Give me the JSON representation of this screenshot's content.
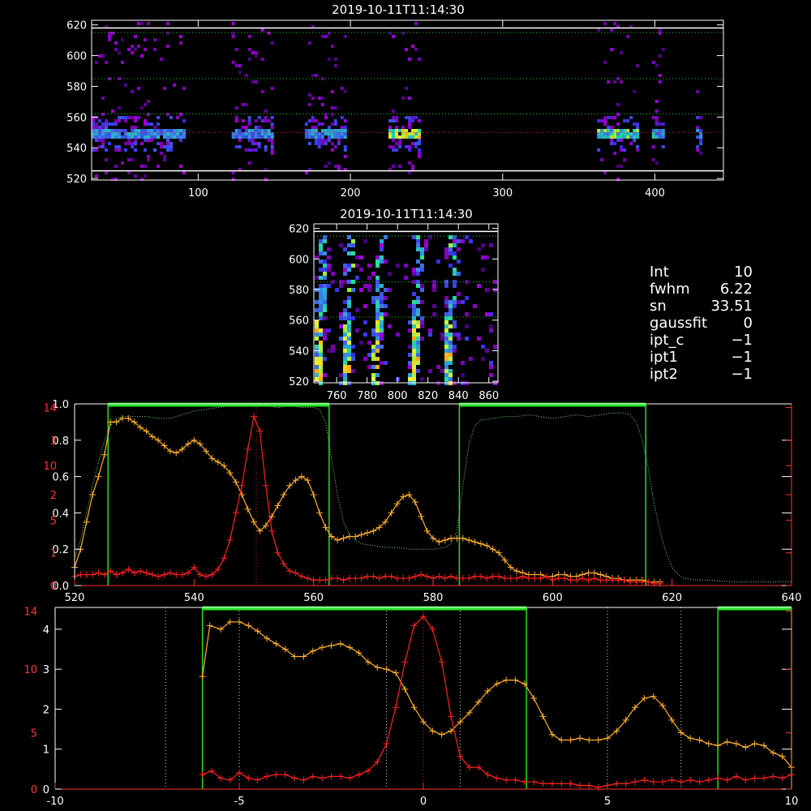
{
  "chart_data": [
    {
      "id": "top_image",
      "type": "heatmap",
      "title": "2019-10-11T11:14:30",
      "xlim": [
        30,
        445
      ],
      "ylim": [
        519,
        623
      ],
      "xticks": [
        100,
        200,
        300,
        400
      ],
      "yticks": [
        520,
        540,
        560,
        580,
        600,
        620
      ],
      "hlines_white": [
        618,
        525
      ],
      "hlines_green": [
        615,
        585,
        562
      ],
      "hlines_red": [
        550
      ],
      "bands": [
        [
          30,
          90
        ],
        [
          122,
          148
        ],
        [
          170,
          197
        ],
        [
          225,
          245
        ],
        [
          362,
          388
        ],
        [
          398,
          405
        ],
        [
          427,
          431
        ]
      ],
      "band_intensity": [
        0.55,
        0.55,
        0.55,
        0.95,
        0.75,
        0.6,
        0.5
      ]
    },
    {
      "id": "zoom_image",
      "type": "heatmap",
      "title": "2019-10-11T11:14:30",
      "xlim": [
        745,
        866
      ],
      "ylim": [
        519,
        623
      ],
      "xticks": [
        760,
        780,
        800,
        820,
        840,
        860
      ],
      "yticks": [
        520,
        540,
        560,
        580,
        600,
        620
      ],
      "hlines_white": [
        618
      ],
      "hlines_green": [
        615,
        585,
        562
      ],
      "streaks": [
        747,
        765,
        785,
        810,
        832
      ]
    },
    {
      "id": "info",
      "type": "table",
      "rows": [
        {
          "label": "Int",
          "value": "10"
        },
        {
          "label": "fwhm",
          "value": "6.22"
        },
        {
          "label": "sn",
          "value": "33.51"
        },
        {
          "label": "gaussfit",
          "value": "0"
        },
        {
          "label": "ipt_c",
          "value": "−1"
        },
        {
          "label": "ipt1",
          "value": "−1"
        },
        {
          "label": "ipt2",
          "value": "−1"
        }
      ]
    },
    {
      "id": "spectrum",
      "type": "line",
      "xlim": [
        520,
        640
      ],
      "xticks": [
        520,
        540,
        560,
        580,
        600,
        620,
        640
      ],
      "yticks_left": [
        "0.0",
        "0.2",
        "0.4",
        "0.6",
        "0.8",
        "1.0"
      ],
      "yticks_left_values": [
        0,
        0.2,
        0.4,
        0.6,
        0.8,
        1.0
      ],
      "yticks_red": [
        "0",
        "1",
        "5",
        "2",
        "10",
        "3",
        "14"
      ],
      "yticks_red_values": [
        0,
        0.18,
        0.36,
        0.5,
        0.66,
        0.8,
        0.98
      ],
      "filter_ranges": [
        [
          525.6,
          562.6
        ],
        [
          584.4,
          615.6
        ]
      ],
      "center_line": 550.4,
      "transmission_x": [
        520,
        521,
        522,
        523,
        524,
        525,
        526,
        527,
        528,
        530,
        532,
        534,
        536,
        538,
        540,
        542,
        544,
        546,
        548,
        550,
        552,
        554,
        556,
        558,
        560,
        561,
        562,
        563,
        564,
        565,
        566,
        567,
        568,
        570,
        572,
        574,
        576,
        578,
        580,
        582,
        583,
        584,
        585,
        586,
        587,
        588,
        590,
        592,
        594,
        596,
        598,
        600,
        602,
        604,
        606,
        608,
        610,
        612,
        613,
        614,
        615,
        616,
        617,
        618,
        619,
        620,
        621,
        622,
        624,
        626,
        630,
        635,
        640
      ],
      "transmission": [
        0.15,
        0.25,
        0.4,
        0.55,
        0.68,
        0.8,
        0.88,
        0.92,
        0.93,
        0.93,
        0.93,
        0.92,
        0.92,
        0.94,
        0.96,
        0.97,
        0.98,
        0.99,
        0.99,
        0.99,
        0.99,
        0.98,
        0.99,
        0.98,
        0.98,
        0.97,
        0.9,
        0.7,
        0.5,
        0.35,
        0.28,
        0.25,
        0.23,
        0.22,
        0.21,
        0.21,
        0.2,
        0.2,
        0.2,
        0.21,
        0.23,
        0.3,
        0.55,
        0.78,
        0.88,
        0.91,
        0.92,
        0.93,
        0.93,
        0.94,
        0.93,
        0.92,
        0.93,
        0.94,
        0.93,
        0.94,
        0.95,
        0.95,
        0.94,
        0.9,
        0.8,
        0.65,
        0.45,
        0.3,
        0.18,
        0.1,
        0.06,
        0.04,
        0.03,
        0.03,
        0.02,
        0.02,
        0.02
      ],
      "orange_x": [
        520,
        521,
        522,
        523,
        524,
        525,
        526,
        527,
        528,
        529,
        530,
        531,
        532,
        533,
        534,
        535,
        536,
        537,
        538,
        539,
        540,
        541,
        542,
        543,
        544,
        545,
        546,
        547,
        548,
        549,
        550,
        551,
        552,
        553,
        554,
        555,
        556,
        557,
        558,
        559,
        560,
        561,
        562,
        563,
        564,
        565,
        566,
        567,
        568,
        569,
        570,
        571,
        572,
        573,
        574,
        575,
        576,
        577,
        578,
        579,
        580,
        581,
        582,
        583,
        584,
        585,
        586,
        587,
        588,
        589,
        590,
        591,
        592,
        593,
        594,
        595,
        596,
        597,
        598,
        599,
        600,
        601,
        602,
        603,
        604,
        605,
        606,
        607,
        608,
        609,
        610,
        611,
        612,
        613,
        614,
        615,
        616,
        617,
        618
      ],
      "orange": [
        0.1,
        0.2,
        0.35,
        0.5,
        0.6,
        0.72,
        0.9,
        0.9,
        0.92,
        0.92,
        0.9,
        0.87,
        0.85,
        0.82,
        0.8,
        0.77,
        0.74,
        0.73,
        0.75,
        0.78,
        0.8,
        0.78,
        0.74,
        0.7,
        0.68,
        0.66,
        0.62,
        0.57,
        0.5,
        0.42,
        0.35,
        0.3,
        0.33,
        0.38,
        0.44,
        0.5,
        0.55,
        0.58,
        0.6,
        0.58,
        0.5,
        0.4,
        0.32,
        0.27,
        0.25,
        0.26,
        0.27,
        0.27,
        0.28,
        0.29,
        0.3,
        0.32,
        0.35,
        0.4,
        0.45,
        0.49,
        0.5,
        0.46,
        0.38,
        0.3,
        0.26,
        0.24,
        0.25,
        0.26,
        0.26,
        0.26,
        0.25,
        0.24,
        0.23,
        0.22,
        0.2,
        0.18,
        0.14,
        0.1,
        0.08,
        0.07,
        0.06,
        0.06,
        0.06,
        0.05,
        0.05,
        0.06,
        0.06,
        0.05,
        0.05,
        0.06,
        0.07,
        0.07,
        0.06,
        0.05,
        0.04,
        0.04,
        0.03,
        0.03,
        0.03,
        0.03,
        0.02,
        0.02,
        0.02
      ],
      "red_x": [
        520,
        521,
        522,
        523,
        524,
        525,
        526,
        527,
        528,
        529,
        530,
        531,
        532,
        533,
        534,
        535,
        536,
        537,
        538,
        539,
        540,
        541,
        542,
        543,
        544,
        545,
        546,
        547,
        548,
        549,
        550,
        551,
        552,
        553,
        554,
        555,
        556,
        557,
        558,
        559,
        560,
        561,
        562,
        563,
        564,
        565,
        566,
        567,
        568,
        569,
        570,
        571,
        572,
        573,
        574,
        575,
        576,
        577,
        578,
        579,
        580,
        581,
        582,
        583,
        584,
        585,
        586,
        587,
        588,
        589,
        590,
        591,
        592,
        593,
        594,
        595,
        596,
        597,
        598,
        599,
        600,
        601,
        602,
        603,
        604,
        605,
        606,
        607,
        608,
        609,
        610,
        611,
        612,
        613,
        614,
        615,
        616,
        617,
        618
      ],
      "red": [
        0.05,
        0.06,
        0.06,
        0.06,
        0.07,
        0.06,
        0.08,
        0.06,
        0.07,
        0.09,
        0.07,
        0.08,
        0.07,
        0.06,
        0.05,
        0.06,
        0.07,
        0.06,
        0.06,
        0.07,
        0.1,
        0.06,
        0.05,
        0.06,
        0.09,
        0.15,
        0.25,
        0.4,
        0.55,
        0.75,
        0.93,
        0.85,
        0.55,
        0.3,
        0.18,
        0.12,
        0.08,
        0.07,
        0.05,
        0.04,
        0.03,
        0.03,
        0.03,
        0.04,
        0.04,
        0.03,
        0.04,
        0.04,
        0.04,
        0.05,
        0.05,
        0.04,
        0.05,
        0.05,
        0.04,
        0.04,
        0.04,
        0.05,
        0.06,
        0.05,
        0.04,
        0.05,
        0.04,
        0.05,
        0.04,
        0.04,
        0.04,
        0.05,
        0.05,
        0.04,
        0.05,
        0.05,
        0.04,
        0.04,
        0.04,
        0.05,
        0.04,
        0.04,
        0.04,
        0.05,
        0.03,
        0.04,
        0.04,
        0.03,
        0.03,
        0.04,
        0.03,
        0.04,
        0.03,
        0.03,
        0.03,
        0.03,
        0.03,
        0.02,
        0.02,
        0.02,
        0.02,
        0.01,
        0.01
      ]
    },
    {
      "id": "velocity",
      "type": "line",
      "xlim": [
        -10,
        10
      ],
      "xticks": [
        -10,
        -5,
        0,
        5,
        10
      ],
      "yticks_left": [
        "0",
        "1",
        "2",
        "3",
        "4"
      ],
      "yticks_left_values": [
        0,
        0.22,
        0.44,
        0.66,
        0.88
      ],
      "yticks_red": [
        "0",
        "5",
        "10",
        "14"
      ],
      "yticks_red_values": [
        0,
        0.31,
        0.66,
        0.98
      ],
      "filter_ranges": [
        [
          -6,
          2.8
        ],
        [
          8,
          10
        ]
      ],
      "dotted_white": [
        -7,
        -5,
        -1,
        1,
        5,
        7
      ],
      "center_line": 0,
      "orange_x": [
        -6,
        -5.8,
        -5.5,
        -5.25,
        -5,
        -4.75,
        -4.5,
        -4.25,
        -4,
        -3.75,
        -3.5,
        -3.25,
        -3,
        -2.75,
        -2.5,
        -2.25,
        -2,
        -1.75,
        -1.5,
        -1.25,
        -1,
        -0.75,
        -0.5,
        -0.25,
        0,
        0.25,
        0.5,
        0.75,
        1,
        1.25,
        1.5,
        1.75,
        2,
        2.25,
        2.5,
        2.75,
        3,
        3.25,
        3.5,
        3.75,
        4,
        4.25,
        4.5,
        4.75,
        5,
        5.25,
        5.5,
        5.75,
        6,
        6.25,
        6.5,
        6.75,
        7,
        7.25,
        7.5,
        7.75,
        8,
        8.25,
        8.5,
        8.75,
        9,
        9.25,
        9.5,
        9.75,
        10
      ],
      "orange": [
        0.62,
        0.9,
        0.88,
        0.92,
        0.92,
        0.9,
        0.87,
        0.83,
        0.8,
        0.77,
        0.73,
        0.73,
        0.76,
        0.78,
        0.79,
        0.8,
        0.78,
        0.75,
        0.7,
        0.67,
        0.66,
        0.64,
        0.55,
        0.45,
        0.37,
        0.32,
        0.3,
        0.32,
        0.37,
        0.42,
        0.48,
        0.54,
        0.58,
        0.6,
        0.6,
        0.58,
        0.5,
        0.4,
        0.3,
        0.27,
        0.27,
        0.28,
        0.27,
        0.27,
        0.28,
        0.32,
        0.38,
        0.45,
        0.5,
        0.51,
        0.46,
        0.38,
        0.31,
        0.28,
        0.27,
        0.25,
        0.24,
        0.26,
        0.25,
        0.23,
        0.25,
        0.24,
        0.2,
        0.18,
        0.12
      ],
      "red_x": [
        -6,
        -5.75,
        -5.5,
        -5.25,
        -5,
        -4.75,
        -4.5,
        -4.25,
        -4,
        -3.75,
        -3.5,
        -3.25,
        -3,
        -2.75,
        -2.5,
        -2.25,
        -2,
        -1.75,
        -1.5,
        -1.25,
        -1,
        -0.75,
        -0.5,
        -0.25,
        0,
        0.25,
        0.5,
        0.75,
        1,
        1.25,
        1.5,
        1.75,
        2,
        2.25,
        2.5,
        2.75,
        3,
        3.25,
        3.5,
        3.75,
        4,
        4.25,
        4.5,
        4.75,
        5,
        5.25,
        5.5,
        5.75,
        6,
        6.25,
        6.5,
        6.75,
        7,
        7.25,
        7.5,
        7.75,
        8,
        8.25,
        8.5,
        8.75,
        9,
        9.25,
        9.5,
        9.75,
        10
      ],
      "red": [
        0.08,
        0.1,
        0.06,
        0.05,
        0.09,
        0.06,
        0.05,
        0.07,
        0.08,
        0.08,
        0.06,
        0.05,
        0.07,
        0.06,
        0.07,
        0.07,
        0.06,
        0.08,
        0.1,
        0.15,
        0.25,
        0.45,
        0.7,
        0.9,
        0.95,
        0.88,
        0.7,
        0.4,
        0.18,
        0.12,
        0.12,
        0.08,
        0.06,
        0.05,
        0.05,
        0.04,
        0.04,
        0.03,
        0.03,
        0.03,
        0.03,
        0.02,
        0.02,
        0.01,
        0.02,
        0.03,
        0.03,
        0.04,
        0.05,
        0.04,
        0.04,
        0.05,
        0.04,
        0.05,
        0.04,
        0.05,
        0.06,
        0.05,
        0.07,
        0.05,
        0.06,
        0.06,
        0.07,
        0.06,
        0.08
      ]
    }
  ]
}
